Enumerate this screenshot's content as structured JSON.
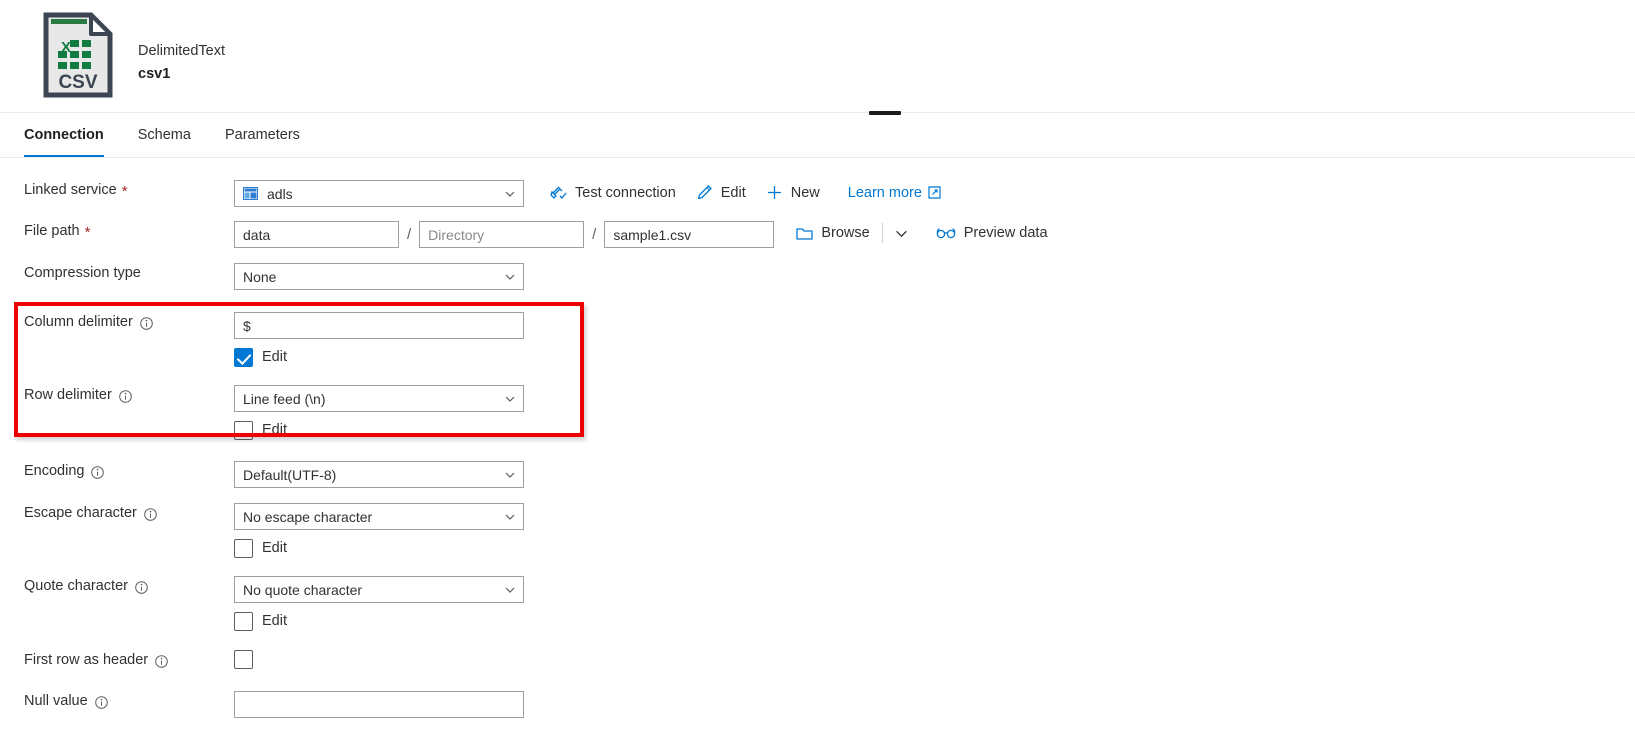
{
  "header": {
    "type_label": "DelimitedText",
    "dataset_name": "csv1",
    "icon": "csv-file-icon",
    "drag_handle": "panel-resize-handle"
  },
  "tabs": [
    {
      "label": "Connection",
      "active": true
    },
    {
      "label": "Schema",
      "active": false
    },
    {
      "label": "Parameters",
      "active": false
    }
  ],
  "form": {
    "linked_service": {
      "label": "Linked service",
      "required": "*",
      "value": "adls",
      "icon": "adls-icon"
    },
    "linked_service_actions": {
      "test_connection": "Test connection",
      "edit": "Edit",
      "new": "New",
      "learn_more": "Learn more"
    },
    "file_path": {
      "label": "File path",
      "required": "*",
      "container_value": "data",
      "directory_placeholder": "Directory",
      "file_value": "sample1.csv",
      "separator": "/",
      "browse": "Browse",
      "preview_data": "Preview data"
    },
    "compression_type": {
      "label": "Compression type",
      "value": "None"
    },
    "column_delimiter": {
      "label": "Column delimiter",
      "value": "$",
      "edit_label": "Edit",
      "edit_checked": true
    },
    "row_delimiter": {
      "label": "Row delimiter",
      "value": "Line feed (\\n)",
      "edit_label": "Edit",
      "edit_checked": false
    },
    "encoding": {
      "label": "Encoding",
      "value": "Default(UTF-8)"
    },
    "escape_character": {
      "label": "Escape character",
      "value": "No escape character",
      "edit_label": "Edit",
      "edit_checked": false
    },
    "quote_character": {
      "label": "Quote character",
      "value": "No quote character",
      "edit_label": "Edit",
      "edit_checked": false
    },
    "first_row_as_header": {
      "label": "First row as header",
      "checked": false
    },
    "null_value": {
      "label": "Null value",
      "value": ""
    }
  },
  "annotation": {
    "highlight_color": "#ee0000",
    "highlight_target": "delimiter-settings"
  },
  "colors": {
    "accent": "#0078d4",
    "required": "#a4262c",
    "text": "#323130",
    "border": "#a19f9d"
  }
}
